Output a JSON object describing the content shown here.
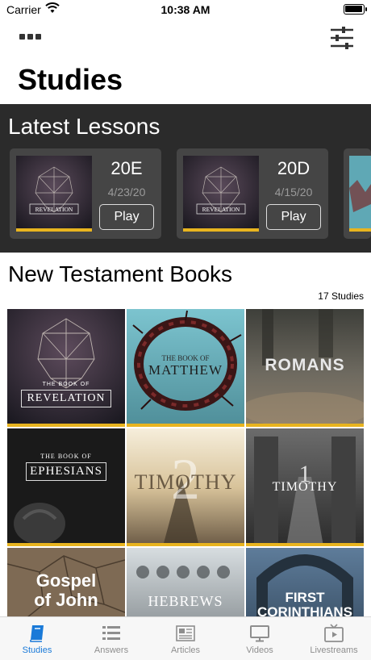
{
  "status_bar": {
    "carrier": "Carrier",
    "time": "10:38 AM",
    "battery_level": 1.0
  },
  "header": {
    "title": "Studies",
    "more_icon": "more-icon",
    "filter_icon": "sliders-icon"
  },
  "latest": {
    "title": "Latest Lessons",
    "lessons": [
      {
        "code": "20E",
        "date": "4/23/20",
        "play_label": "Play",
        "artwork": "REVELATION"
      },
      {
        "code": "20D",
        "date": "4/15/20",
        "play_label": "Play",
        "artwork": "REVELATION"
      }
    ]
  },
  "books": {
    "title": "New Testament Books",
    "count": "17 Studies",
    "tiles": [
      {
        "top": "THE BOOK OF",
        "name": "REVELATION"
      },
      {
        "top": "THE BOOK OF",
        "name": "MATTHEW"
      },
      {
        "top": "",
        "name": "ROMANS"
      },
      {
        "top": "THE BOOK OF",
        "name": "EPHESIANS"
      },
      {
        "top": "2",
        "name": "TIMOTHY"
      },
      {
        "top": "1",
        "name": "TIMOTHY"
      },
      {
        "top": "Gospel",
        "name": "of John"
      },
      {
        "top": "",
        "name": "HEBREWS"
      },
      {
        "top": "FIRST",
        "name": "CORINTHIANS"
      }
    ]
  },
  "tabs": [
    {
      "label": "Studies",
      "icon": "book-icon",
      "active": true
    },
    {
      "label": "Answers",
      "icon": "list-icon",
      "active": false
    },
    {
      "label": "Articles",
      "icon": "newspaper-icon",
      "active": false
    },
    {
      "label": "Videos",
      "icon": "monitor-icon",
      "active": false
    },
    {
      "label": "Livestreams",
      "icon": "tv-play-icon",
      "active": false
    }
  ],
  "colors": {
    "accent": "#1a7ad8",
    "tile_bar": "#e8b41f",
    "dark_section": "#2b2b2b",
    "card": "#454545"
  }
}
